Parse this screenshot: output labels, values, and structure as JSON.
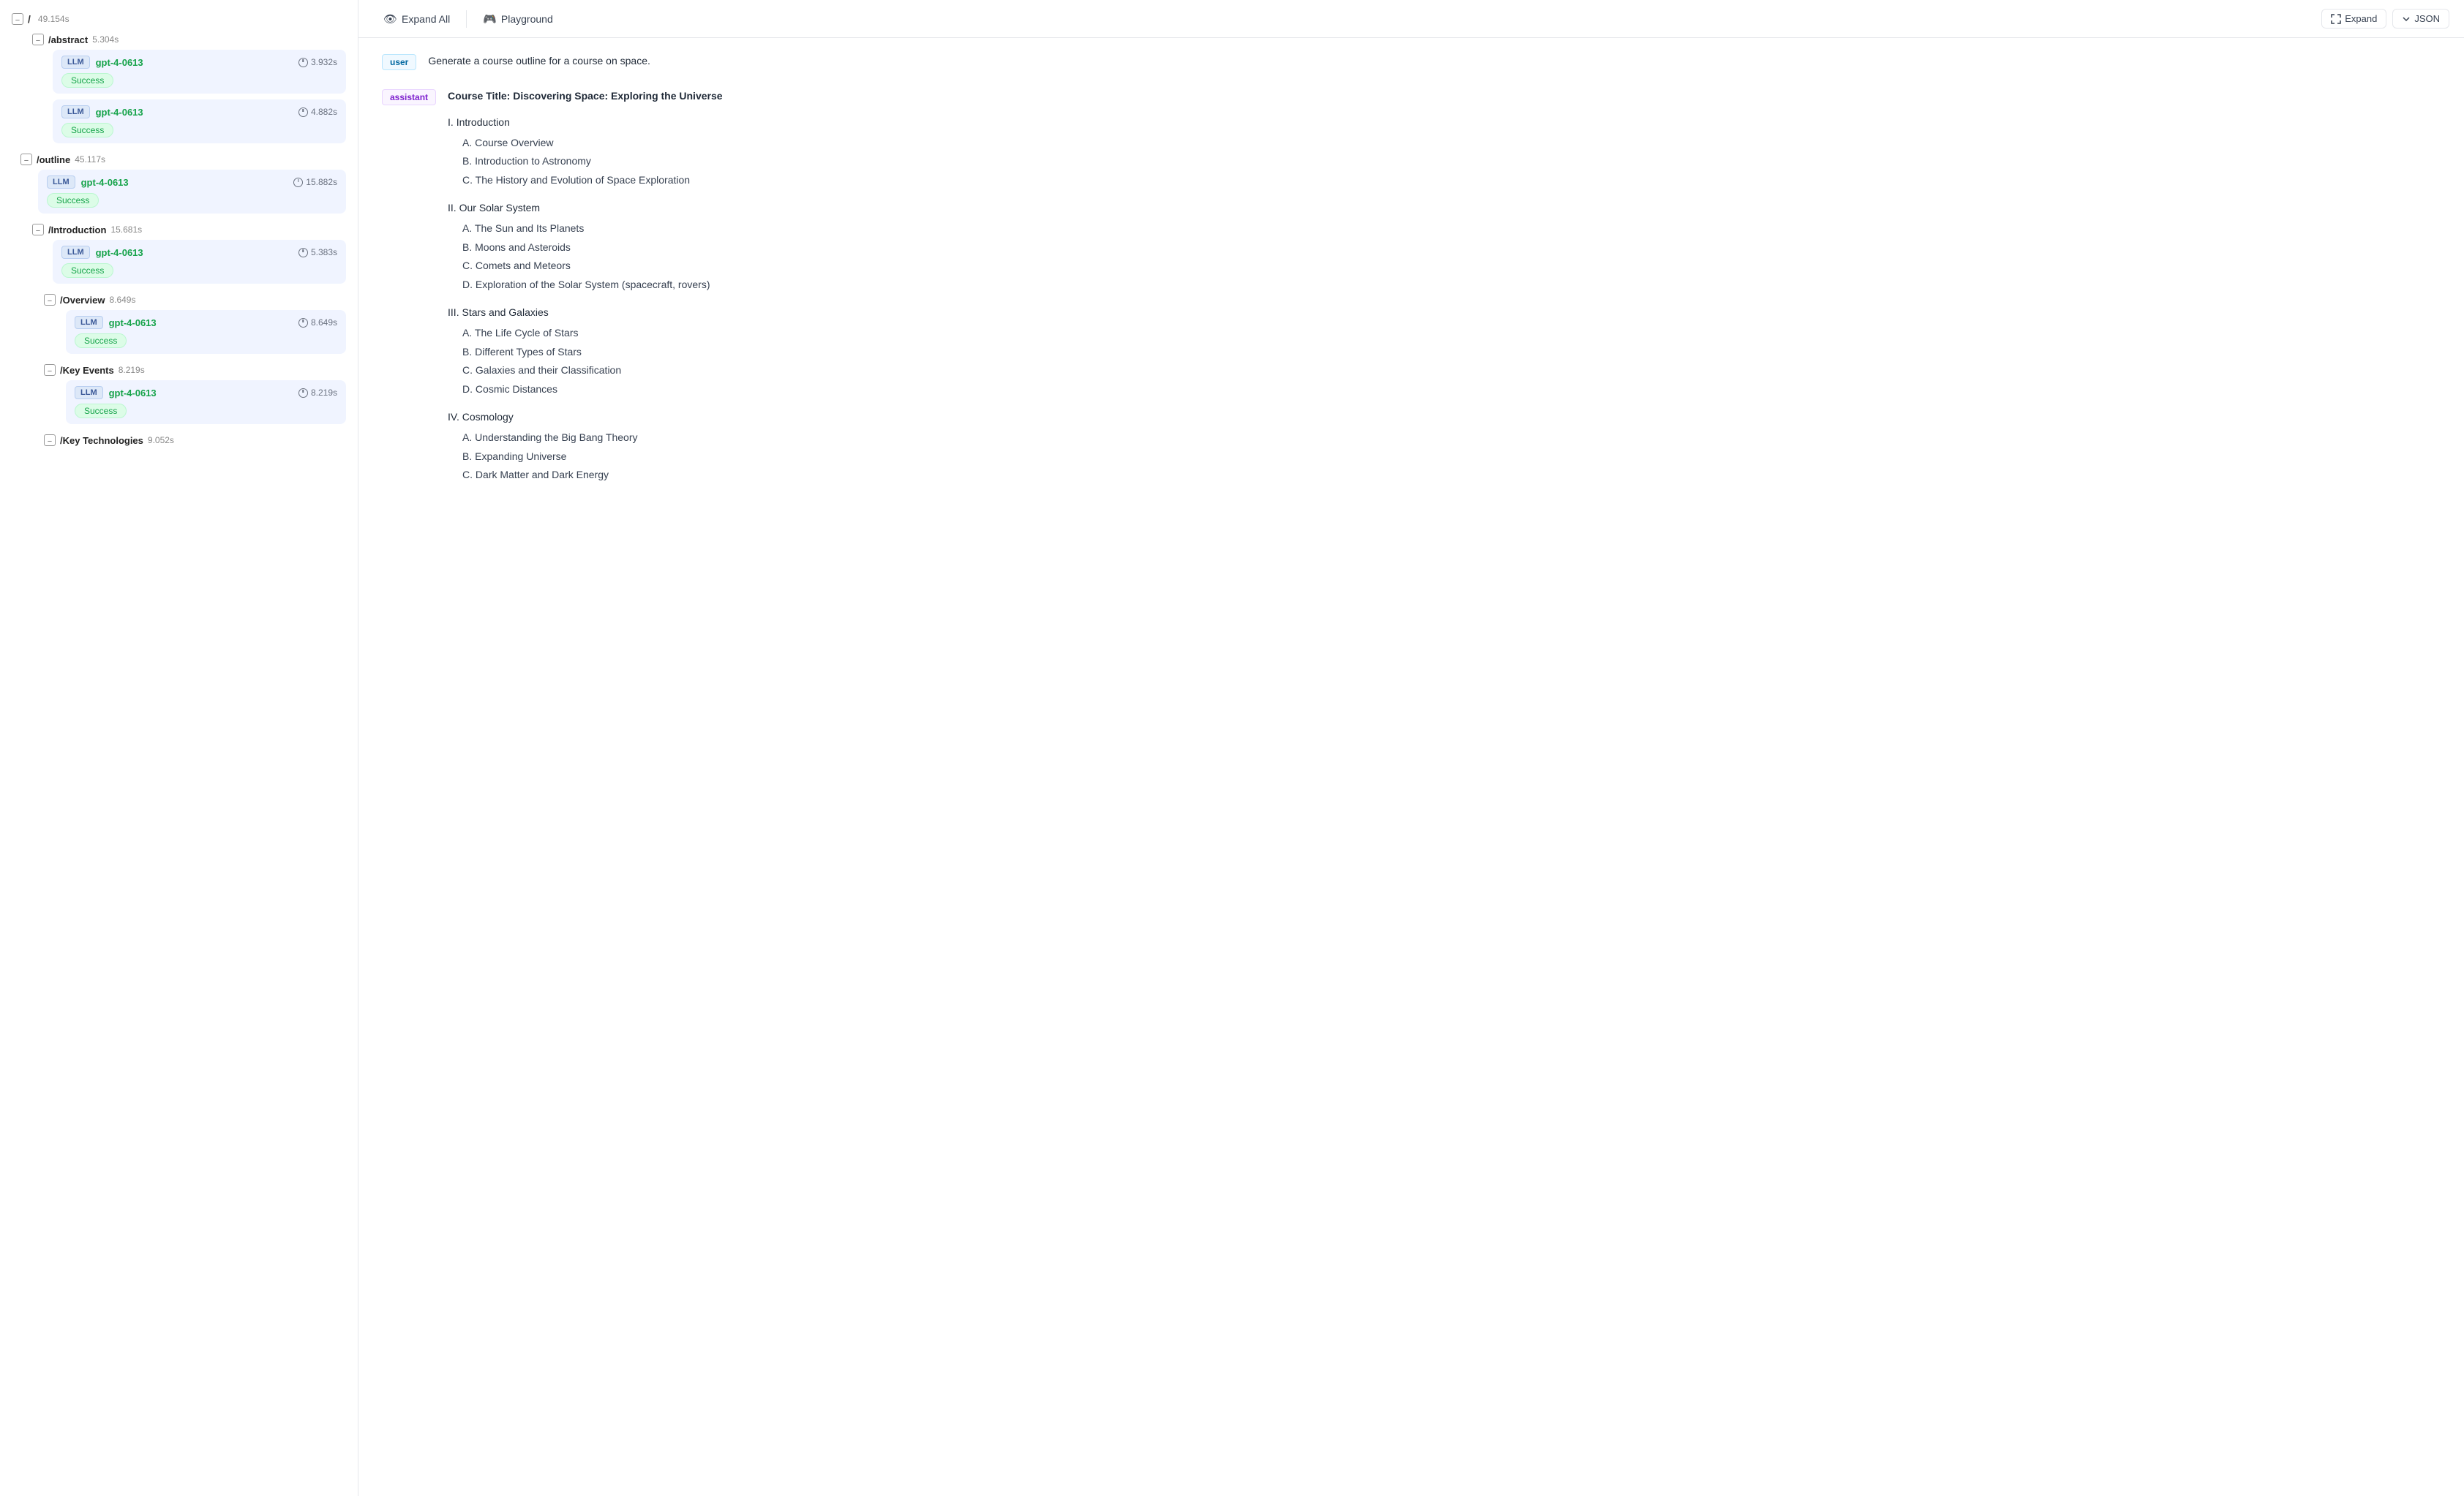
{
  "left_panel": {
    "root": {
      "slash": "/",
      "time": "49.154s"
    },
    "sections": [
      {
        "name": "/abstract",
        "time": "5.304s",
        "indent": 1,
        "llm_nodes": [
          {
            "model": "gpt-4-0613",
            "time": "3.932s",
            "status": "Success"
          },
          {
            "model": "gpt-4-0613",
            "time": "4.882s",
            "status": "Success"
          }
        ]
      },
      {
        "name": "/outline",
        "time": "45.117s",
        "indent": 0,
        "llm_nodes": [
          {
            "model": "gpt-4-0613",
            "time": "15.882s",
            "status": "Success"
          }
        ]
      },
      {
        "name": "/Introduction",
        "time": "15.681s",
        "indent": 1,
        "llm_nodes": [
          {
            "model": "gpt-4-0613",
            "time": "5.383s",
            "status": "Success"
          }
        ]
      },
      {
        "name": "/Overview",
        "time": "8.649s",
        "indent": 2,
        "llm_nodes": [
          {
            "model": "gpt-4-0613",
            "time": "8.649s",
            "status": "Success"
          }
        ]
      },
      {
        "name": "/Key Events",
        "time": "8.219s",
        "indent": 2,
        "llm_nodes": [
          {
            "model": "gpt-4-0613",
            "time": "8.219s",
            "status": "Success"
          }
        ]
      },
      {
        "name": "/Key Technologies",
        "time": "9.052s",
        "indent": 2,
        "llm_nodes": []
      }
    ]
  },
  "toolbar": {
    "expand_all_label": "Expand All",
    "playground_label": "Playground",
    "expand_label": "Expand",
    "json_label": "JSON"
  },
  "messages": [
    {
      "role": "user",
      "content": "Generate a course outline for a course on space."
    },
    {
      "role": "assistant",
      "title": "Course Title: Discovering Space: Exploring the Universe",
      "sections": [
        {
          "heading": "I. Introduction",
          "items": [
            "A. Course Overview",
            "B. Introduction to Astronomy",
            "C. The History and Evolution of Space Exploration"
          ]
        },
        {
          "heading": "II. Our Solar System",
          "items": [
            "A. The Sun and Its Planets",
            "B. Moons and Asteroids",
            "C. Comets and Meteors",
            "D. Exploration of the Solar System (spacecraft, rovers)"
          ]
        },
        {
          "heading": "III. Stars and Galaxies",
          "items": [
            "A. The Life Cycle of Stars",
            "B. Different Types of Stars",
            "C. Galaxies and their Classification",
            "D. Cosmic Distances"
          ]
        },
        {
          "heading": "IV. Cosmology",
          "items": [
            "A. Understanding the Big Bang Theory",
            "B. Expanding Universe",
            "C. Dark Matter and Dark Energy"
          ]
        }
      ]
    }
  ]
}
